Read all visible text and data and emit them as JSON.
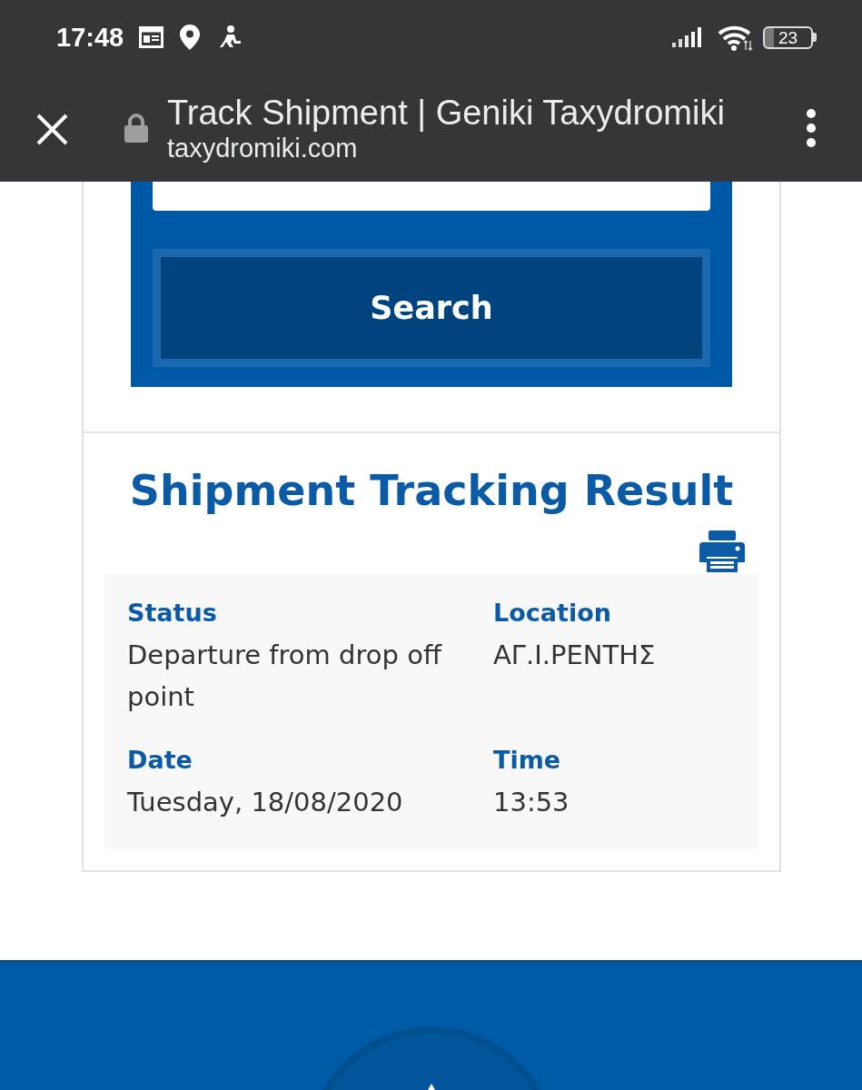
{
  "status_bar": {
    "time": "17:48",
    "battery_percent": "23"
  },
  "browser_toolbar": {
    "page_title": "Track Shipment | Geniki Taxydromiki",
    "url": "taxydromiki.com"
  },
  "search_form": {
    "button": "Search"
  },
  "result": {
    "title": "Shipment Tracking Result",
    "fields": [
      {
        "label": "Status",
        "value": "Departure from drop off point"
      },
      {
        "label": "Location",
        "value": "ΑΓ.Ι.ΡΕΝΤΗΣ"
      },
      {
        "label": "Date",
        "value": "Tuesday, 18/08/2020"
      },
      {
        "label": "Time",
        "value": "13:53"
      }
    ]
  }
}
